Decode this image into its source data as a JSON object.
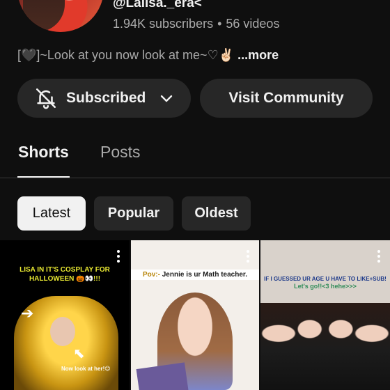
{
  "channel": {
    "handle": "@Lalisa._era<",
    "subscribers": "1.94K subscribers",
    "separator": "•",
    "videos": "56 videos",
    "description": "[🖤]~Look at you now look at me~♡✌🏻",
    "more_label": "...more"
  },
  "actions": {
    "subscribed_label": "Subscribed",
    "community_label": "Visit Community"
  },
  "tabs": [
    {
      "label": "Shorts",
      "selected": true
    },
    {
      "label": "Posts",
      "selected": false
    }
  ],
  "filters": [
    {
      "label": "Latest",
      "selected": true
    },
    {
      "label": "Popular",
      "selected": false
    },
    {
      "label": "Oldest",
      "selected": false
    }
  ],
  "shorts": [
    {
      "caption": "LISA IN IT'S COSPLAY FOR HALLOWEEN 🎃👀!!!",
      "overlay_text": "Now look at her!😊"
    },
    {
      "caption_pov": "Pov:- ",
      "caption": "Jennie is ur Math teacher."
    },
    {
      "caption": "IF I GUESSED UR AGE U HAVE TO LIKE+SUB!",
      "caption_sub": "Let's go!!<3 hehe>>>"
    }
  ],
  "icons": {
    "bell": "bell-slash-icon",
    "chevron": "chevron-down-icon",
    "more": "more-vertical-icon"
  }
}
